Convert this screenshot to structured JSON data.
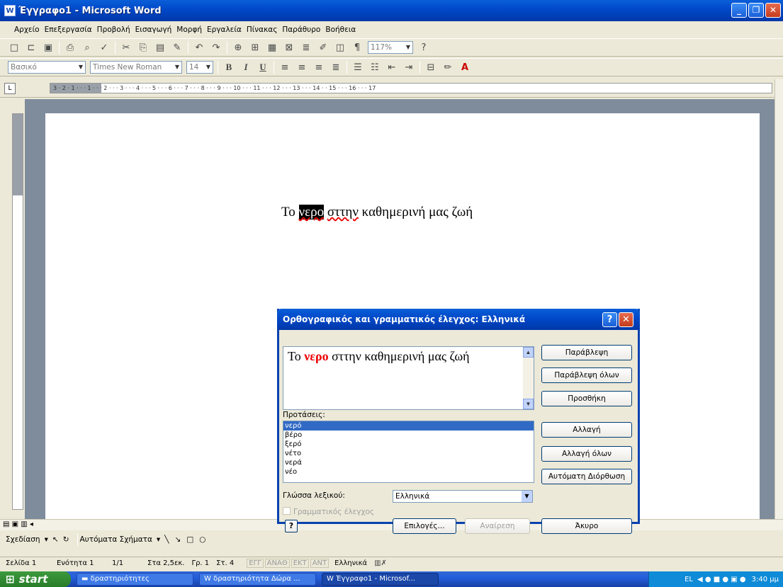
{
  "window": {
    "title": "Έγγραφο1 - Microsoft Word",
    "app_icon": "W"
  },
  "menu": [
    "Αρχείο",
    "Επεξεργασία",
    "Προβολή",
    "Εισαγωγή",
    "Μορφή",
    "Εργαλεία",
    "Πίνακας",
    "Παράθυρο",
    "Βοήθεια"
  ],
  "format_toolbar": {
    "style": "Βασικό",
    "font": "Times New Roman",
    "size": "14",
    "zoom": "117%"
  },
  "ruler_text": "3 · 2 · 1 · · · 1 · · · 2 · · · 3 · · · 4 · · · 5 · · · 6 · · · 7 · · · 8 · · · 9 · · · 10 · · · 11 · · · 12 · · · 13 · · · 14 · · 15 · · · 16 · · · 17",
  "document": {
    "before": "Το ",
    "word": "νερο",
    "space": " ",
    "misspelled": "σττην",
    "after": " καθημερινή μας ζωή"
  },
  "dialog": {
    "title": "Ορθογραφικός και γραμματικός έλεγχος: Ελληνικά",
    "sentence": {
      "before": "Το ",
      "word": "νερο",
      "after": " σττην καθημερινή μας ζωή"
    },
    "suggestions_label": "Προτάσεις:",
    "suggestions": [
      "νερό",
      "βέρο",
      "ξερό",
      "νέτο",
      "νερά",
      "νέο"
    ],
    "dictionary_language_label": "Γλώσσα λεξικού:",
    "dictionary_language": "Ελληνικά",
    "grammar_check_label": "Γραμματικός έλεγχος",
    "buttons": {
      "ignore": "Παράβλεψη",
      "ignore_all": "Παράβλεψη όλων",
      "add": "Προσθήκη",
      "change": "Αλλαγή",
      "change_all": "Αλλαγή όλων",
      "autocorrect": "Αυτόματη Διόρθωση",
      "options": "Επιλογές...",
      "undo": "Αναίρεση",
      "cancel": "Άκυρο"
    }
  },
  "drawing": {
    "draw": "Σχεδίαση",
    "autoshapes": "Αυτόματα Σχήματα"
  },
  "status": {
    "page": "Σελίδα 1",
    "section": "Ενότητα 1",
    "pages": "1/1",
    "at": "Στα 2,5εκ.",
    "line": "Γρ. 1",
    "col": "Στ. 4",
    "rec": "ΕΓΓ",
    "trk": "ΑΝΑΘ",
    "ext": "ΕΚΤ",
    "ovr": "ΑΝΤ",
    "lang": "Ελληνικά"
  },
  "taskbar": {
    "start": "start",
    "tasks": [
      "δραστηριότητες",
      "δραστηριότητα Δώρα ...",
      "Έγγραφο1 - Microsof..."
    ],
    "lang": "EL",
    "clock": "3:40 μμ"
  }
}
